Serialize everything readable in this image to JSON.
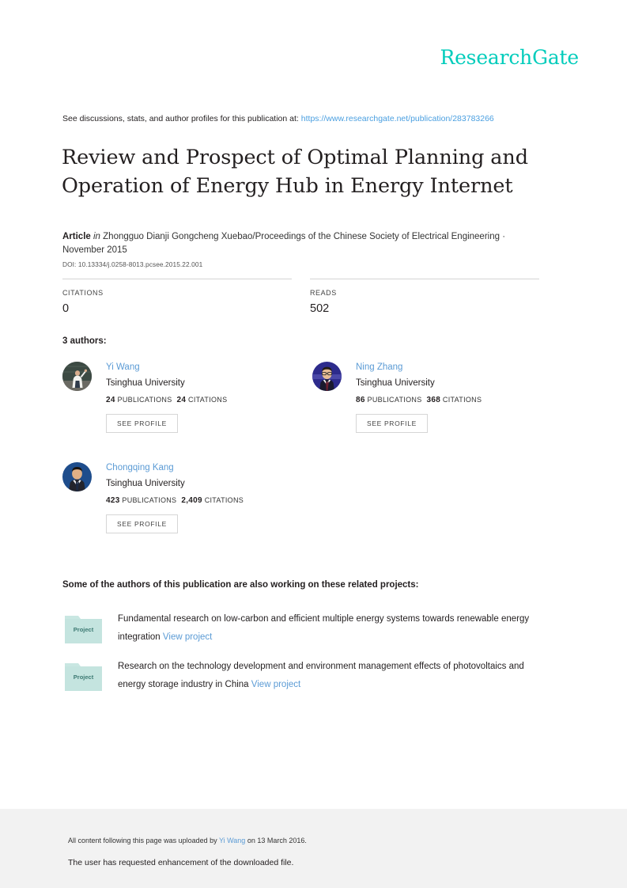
{
  "brand": {
    "logo_text": "ResearchGate",
    "logo_color": "#00ccbb"
  },
  "discussion": {
    "prefix": "See discussions, stats, and author profiles for this publication at:",
    "url": "https://www.researchgate.net/publication/283783266",
    "link_color": "#4a9fe0"
  },
  "publication": {
    "title": "Review and Prospect of Optimal Planning and Operation of Energy Hub in Energy Internet",
    "type": "Article",
    "in_word": "in",
    "venue": "Zhongguo Dianji Gongcheng Xuebao/Proceedings of the Chinese Society of Electrical Engineering · November 2015",
    "doi": "DOI: 10.13334/j.0258-8013.pcsee.2015.22.001"
  },
  "stats": {
    "citations_label": "CITATIONS",
    "citations_value": "0",
    "reads_label": "READS",
    "reads_value": "502"
  },
  "authors_section": {
    "heading": "3 authors:",
    "see_profile_label": "SEE PROFILE",
    "publications_label": "PUBLICATIONS",
    "citations_label": "CITATIONS",
    "authors": [
      {
        "name": "Yi Wang",
        "affiliation": "Tsinghua University",
        "publications": "24",
        "citations": "24",
        "avatar": "photo-avatar-blackboard"
      },
      {
        "name": "Ning Zhang",
        "affiliation": "Tsinghua University",
        "publications": "86",
        "citations": "368",
        "avatar": "photo-avatar-glasses"
      },
      {
        "name": "Chongqing Kang",
        "affiliation": "Tsinghua University",
        "publications": "423",
        "citations": "2,409",
        "avatar": "photo-avatar-suit"
      }
    ]
  },
  "projects_section": {
    "heading": "Some of the authors of this publication are also working on these related projects:",
    "icon_label": "Project",
    "view_label": "View project",
    "projects": [
      {
        "title": "Fundamental research on low-carbon and efficient multiple energy systems towards renewable energy integration"
      },
      {
        "title": "Research on the technology development and environment management effects of photovoltaics and energy storage industry in China"
      }
    ]
  },
  "footer": {
    "line1_prefix": "All content following this page was uploaded by",
    "line1_user": "Yi Wang",
    "line1_suffix": "on 13 March 2016.",
    "line2": "The user has requested enhancement of the downloaded file."
  }
}
